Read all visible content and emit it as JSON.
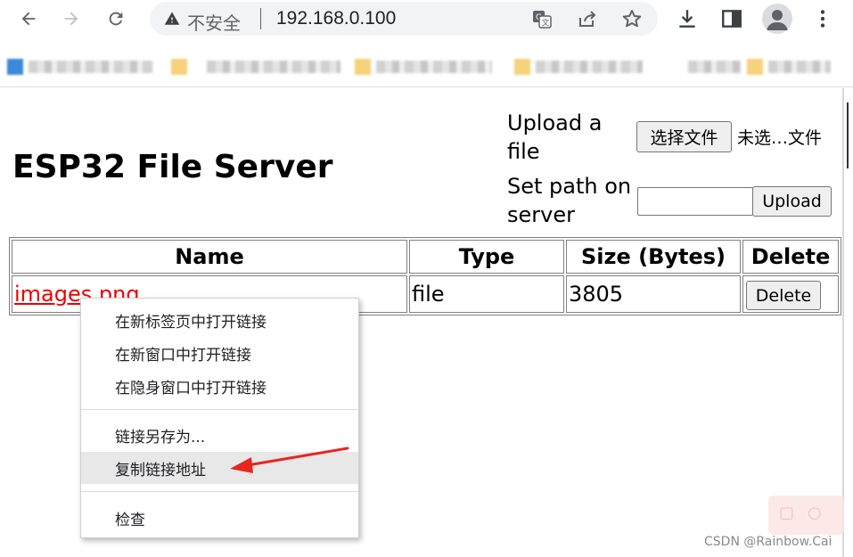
{
  "browser": {
    "security_label": "不安全",
    "url": "192.168.0.100",
    "icons": [
      "back-icon",
      "forward-icon",
      "reload-icon",
      "warning-icon",
      "translate-icon",
      "share-icon",
      "bookmark-star-icon",
      "download-icon",
      "side-panel-icon",
      "profile-icon",
      "more-menu-icon"
    ]
  },
  "page": {
    "title": "ESP32 File Server",
    "upload_label": "Upload a file",
    "choose_file_label": "选择文件",
    "no_file_label": "未选…文件",
    "path_label": "Set path on server",
    "path_value": "",
    "upload_button_label": "Upload"
  },
  "table": {
    "headers": [
      "Name",
      "Type",
      "Size (Bytes)",
      "Delete"
    ],
    "rows": [
      {
        "name": "images.png",
        "type": "file",
        "size": "3805",
        "delete_label": "Delete"
      }
    ]
  },
  "context_menu": {
    "items": [
      "在新标签页中打开链接",
      "在新窗口中打开链接",
      "在隐身窗口中打开链接",
      "链接另存为...",
      "复制链接地址",
      "检查"
    ],
    "highlighted": "复制链接地址"
  },
  "annotation_color": "#e8251f",
  "watermark": "CSDN @Rainbow.Cai"
}
